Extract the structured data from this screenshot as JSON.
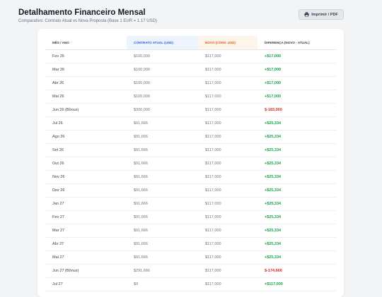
{
  "header": {
    "title": "Detalhamento Financeiro Mensal",
    "subtitle": "Comparativo: Contrato Atual vs Nova Proposta (Base 1 EUR = 1.17 USD)"
  },
  "toolbar": {
    "print_label": "Imprimir / PDF",
    "print_icon": "printer-icon"
  },
  "colors": {
    "positive": "#16a34a",
    "negative": "#dc2626",
    "current_header": "#2563eb",
    "new_header": "#ea580c"
  },
  "table": {
    "headers": [
      "Mês / Ano",
      "Contrato Atual (USD)",
      "Novo (Conv. USD)",
      "Diferença (Novo - Atual)"
    ],
    "rows": [
      {
        "month": "Fev 26",
        "current": "$100,000",
        "new": "$117,000",
        "diff": "+$17,000",
        "sign": "pos"
      },
      {
        "month": "Mar 26",
        "current": "$100,000",
        "new": "$117,000",
        "diff": "+$17,000",
        "sign": "pos"
      },
      {
        "month": "Abr 26",
        "current": "$100,000",
        "new": "$117,000",
        "diff": "+$17,000",
        "sign": "pos"
      },
      {
        "month": "Mai 26",
        "current": "$100,000",
        "new": "$117,000",
        "diff": "+$17,000",
        "sign": "pos"
      },
      {
        "month": "Jun 26 (Bônus)",
        "current": "$300,000",
        "new": "$117,000",
        "diff": "$-183,000",
        "sign": "neg"
      },
      {
        "month": "Jul 26",
        "current": "$91,666",
        "new": "$117,000",
        "diff": "+$25,334",
        "sign": "pos"
      },
      {
        "month": "Ago 26",
        "current": "$91,666",
        "new": "$117,000",
        "diff": "+$25,334",
        "sign": "pos"
      },
      {
        "month": "Set 26",
        "current": "$91,666",
        "new": "$117,000",
        "diff": "+$25,334",
        "sign": "pos"
      },
      {
        "month": "Out 26",
        "current": "$91,666",
        "new": "$117,000",
        "diff": "+$25,334",
        "sign": "pos"
      },
      {
        "month": "Nov 26",
        "current": "$91,666",
        "new": "$117,000",
        "diff": "+$25,334",
        "sign": "pos"
      },
      {
        "month": "Dez 26",
        "current": "$91,666",
        "new": "$117,000",
        "diff": "+$25,334",
        "sign": "pos"
      },
      {
        "month": "Jan 27",
        "current": "$91,666",
        "new": "$117,000",
        "diff": "+$25,334",
        "sign": "pos"
      },
      {
        "month": "Fev 27",
        "current": "$91,666",
        "new": "$117,000",
        "diff": "+$25,334",
        "sign": "pos"
      },
      {
        "month": "Mar 27",
        "current": "$91,666",
        "new": "$117,000",
        "diff": "+$25,334",
        "sign": "pos"
      },
      {
        "month": "Abr 27",
        "current": "$91,666",
        "new": "$117,000",
        "diff": "+$25,334",
        "sign": "pos"
      },
      {
        "month": "Mai 27",
        "current": "$91,666",
        "new": "$117,000",
        "diff": "+$25,334",
        "sign": "pos"
      },
      {
        "month": "Jun 27 (Bônus)",
        "current": "$291,666",
        "new": "$117,000",
        "diff": "$-174,666",
        "sign": "neg"
      },
      {
        "month": "Jul 27",
        "current": "$0",
        "new": "$117,000",
        "diff": "+$117,000",
        "sign": "pos"
      }
    ]
  }
}
